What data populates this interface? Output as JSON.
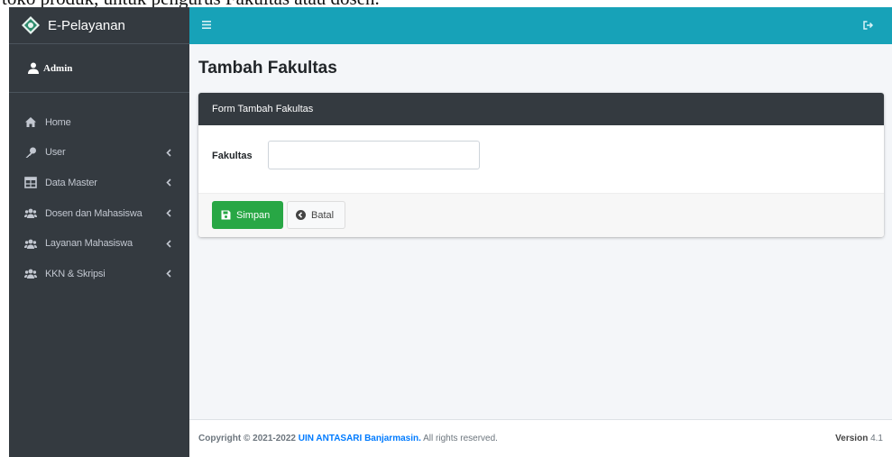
{
  "document": {
    "bleed_text": "toko produk, untuk pengurus Fakultas atau dosen."
  },
  "sidebar": {
    "brand": "E-Pelayanan",
    "user": "Admin",
    "items": [
      {
        "label": "Home",
        "icon": "home-icon",
        "has_submenu": false
      },
      {
        "label": "User",
        "icon": "key-icon",
        "has_submenu": true
      },
      {
        "label": "Data Master",
        "icon": "table-icon",
        "has_submenu": true
      },
      {
        "label": "Dosen dan Mahasiswa",
        "icon": "users-icon",
        "has_submenu": true
      },
      {
        "label": "Layanan Mahasiswa",
        "icon": "users-icon",
        "has_submenu": true
      },
      {
        "label": "KKN & Skripsi",
        "icon": "users-icon",
        "has_submenu": true
      }
    ]
  },
  "topbar": {
    "menu_icon": "hamburger-icon",
    "logout_icon": "sign-out-icon"
  },
  "main": {
    "page_title": "Tambah Fakultas",
    "card_title": "Form Tambah Fakultas",
    "field_label": "Fakultas",
    "field_value": "",
    "field_placeholder": "",
    "save_label": "Simpan",
    "cancel_label": "Batal"
  },
  "footer": {
    "copyright": "Copyright © 2021-2022",
    "org": "UIN ANTASARI Banjarmasin.",
    "rights": "All rights reserved.",
    "version_label": "Version",
    "version": "4.1"
  },
  "colors": {
    "sidebar_bg": "#343a40",
    "topbar_bg": "#17a2b8",
    "card_header_bg": "#343a40",
    "save_button": "#28a745",
    "link": "#007bff"
  }
}
